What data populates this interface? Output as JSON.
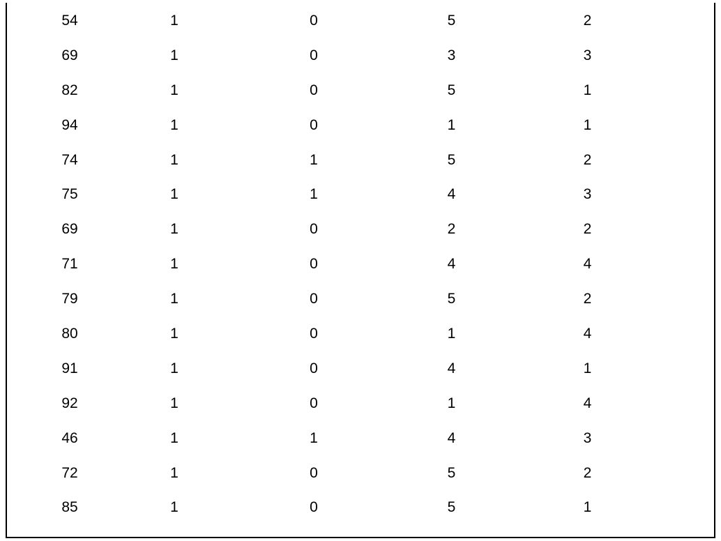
{
  "chart_data": {
    "type": "table",
    "rows": [
      [
        54,
        1,
        0,
        5,
        2
      ],
      [
        69,
        1,
        0,
        3,
        3
      ],
      [
        82,
        1,
        0,
        5,
        1
      ],
      [
        94,
        1,
        0,
        1,
        1
      ],
      [
        74,
        1,
        1,
        5,
        2
      ],
      [
        75,
        1,
        1,
        4,
        3
      ],
      [
        69,
        1,
        0,
        2,
        2
      ],
      [
        71,
        1,
        0,
        4,
        4
      ],
      [
        79,
        1,
        0,
        5,
        2
      ],
      [
        80,
        1,
        0,
        1,
        4
      ],
      [
        91,
        1,
        0,
        4,
        1
      ],
      [
        92,
        1,
        0,
        1,
        4
      ],
      [
        46,
        1,
        1,
        4,
        3
      ],
      [
        72,
        1,
        0,
        5,
        2
      ],
      [
        85,
        1,
        0,
        5,
        1
      ]
    ]
  }
}
